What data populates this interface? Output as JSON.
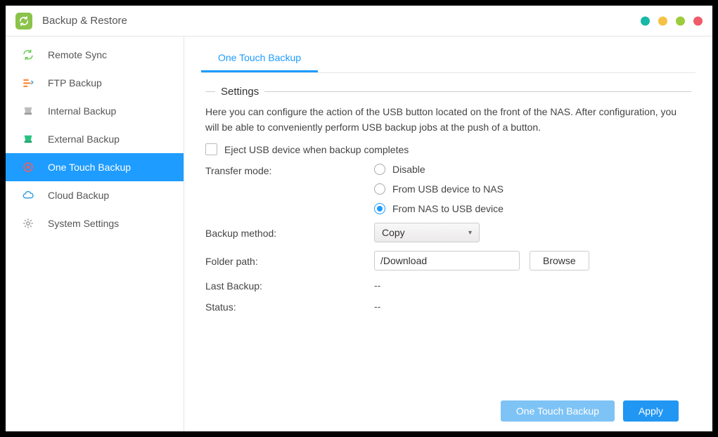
{
  "header": {
    "title": "Backup & Restore"
  },
  "sidebar": {
    "items": [
      {
        "label": "Remote Sync"
      },
      {
        "label": "FTP Backup"
      },
      {
        "label": "Internal Backup"
      },
      {
        "label": "External Backup"
      },
      {
        "label": "One Touch Backup"
      },
      {
        "label": "Cloud Backup"
      },
      {
        "label": "System Settings"
      }
    ]
  },
  "tabs": {
    "active": "One Touch Backup"
  },
  "settings": {
    "heading": "Settings",
    "description": "Here you can configure the action of the USB button located on the front of the NAS. After configuration, you will be able to conveniently perform USB backup jobs at the push of a button.",
    "eject_label": "Eject USB device when backup completes",
    "transfer_mode_label": "Transfer mode:",
    "transfer_options": {
      "disable": "Disable",
      "usb_to_nas": "From USB device to NAS",
      "nas_to_usb": "From NAS to USB device"
    },
    "backup_method_label": "Backup method:",
    "backup_method_value": "Copy",
    "folder_path_label": "Folder path:",
    "folder_path_value": "/Download",
    "browse_label": "Browse",
    "last_backup_label": "Last Backup:",
    "last_backup_value": "--",
    "status_label": "Status:",
    "status_value": "--"
  },
  "footer": {
    "one_touch_label": "One Touch Backup",
    "apply_label": "Apply"
  }
}
